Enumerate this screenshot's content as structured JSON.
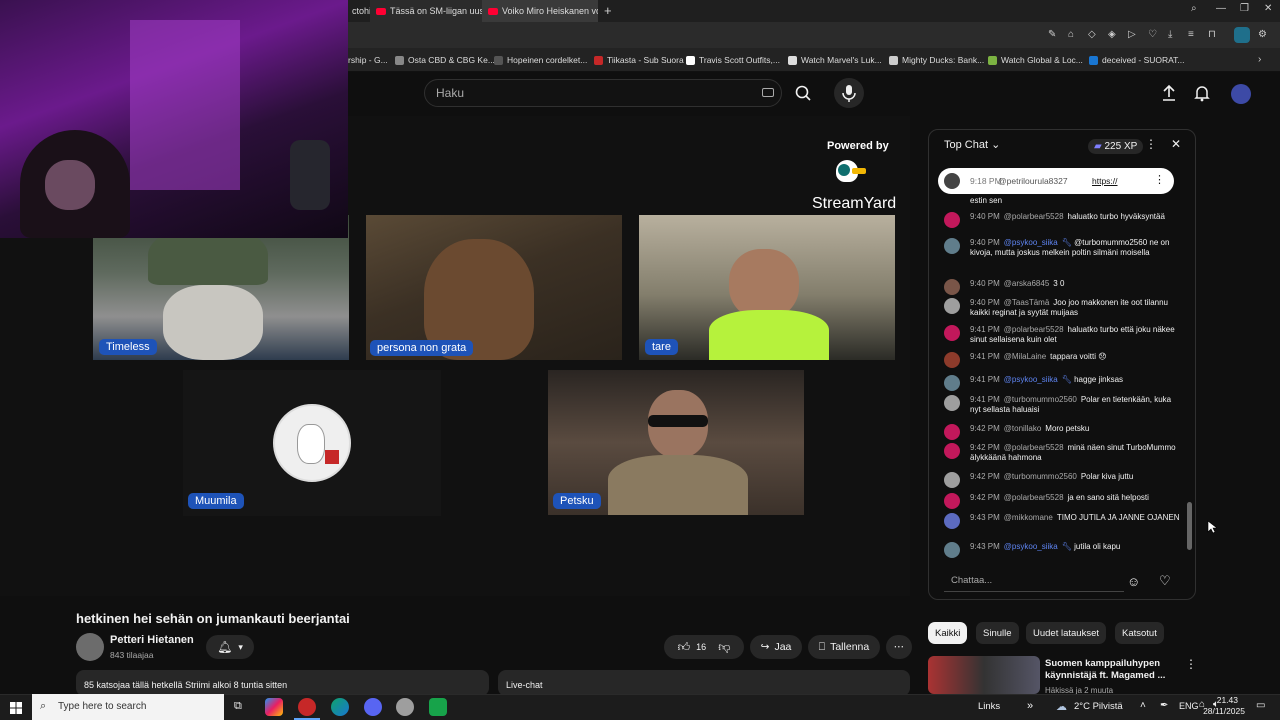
{
  "tabs": [
    {
      "title": "ctohi"
    },
    {
      "title": "Tässä on SM-liigan uusi c"
    },
    {
      "title": "Voiko Miro Heiskanen voi"
    }
  ],
  "bookmarks": [
    {
      "label": "rship - G..."
    },
    {
      "label": "Osta CBD & CBG Ke..."
    },
    {
      "label": "Hopeinen cordelket..."
    },
    {
      "label": "Tiikasta - Sub Suora"
    },
    {
      "label": "Travis Scott Outfits,..."
    },
    {
      "label": "Watch Marvel's Luk..."
    },
    {
      "label": "Mighty Ducks: Bank..."
    },
    {
      "label": "Watch Global & Loc..."
    },
    {
      "label": "deceived - SUORAT..."
    }
  ],
  "search": {
    "placeholder": "Haku"
  },
  "stream": {
    "powered_by": "Powered by",
    "brand": "StreamYard",
    "participants": [
      {
        "name": "Timeless"
      },
      {
        "name": "persona non grata"
      },
      {
        "name": "tare"
      },
      {
        "name": "Muumila"
      },
      {
        "name": "Petsku"
      }
    ]
  },
  "video": {
    "title": "hetkinen hei sehän on jumankauti beerjantai",
    "channel": "Petteri Hietanen",
    "subscribers": "843 tilaajaa",
    "likes": "16",
    "share_label": "Jaa",
    "save_label": "Tallenna",
    "description": "85 katsojaa tällä hetkellä  Striimi alkoi 8 tuntia sitten",
    "livechat_label": "Live-chat"
  },
  "chat": {
    "mode": "Top Chat",
    "xp": "225 XP",
    "pinned": {
      "time": "9:18 PM",
      "author": "@petrilourula8327",
      "text": "https://"
    },
    "messages": [
      {
        "time": "",
        "author": "",
        "text": "estin sen",
        "color": "#444444",
        "mod": false
      },
      {
        "time": "9:40 PM",
        "author": "@polarbear5528",
        "text": "haluatko turbo hyväksyntää",
        "color": "#c2185b",
        "mod": false
      },
      {
        "time": "9:40 PM",
        "author": "@psykoo_siika",
        "text": "@turbomummo2560 ne on kivoja, mutta joskus melkein poltin silmäni moisella",
        "color": "#607d8b",
        "mod": true
      },
      {
        "time": "9:40 PM",
        "author": "@arska6845",
        "text": "3 0",
        "color": "#795548",
        "mod": false
      },
      {
        "time": "9:40 PM",
        "author": "@TaasTämä",
        "text": "Joo joo makkonen ite oot tilannu kaikki reginat ja syytät muijaas",
        "color": "#9e9e9e",
        "mod": false
      },
      {
        "time": "9:41 PM",
        "author": "@polarbear5528",
        "text": "haluatko turbo että joku näkee sinut sellaisena kuin olet",
        "color": "#c2185b",
        "mod": false
      },
      {
        "time": "9:41 PM",
        "author": "@MilaLaine",
        "text": "tappara voitti 😞",
        "color": "#8d3b2b",
        "mod": false
      },
      {
        "time": "9:41 PM",
        "author": "@psykoo_siika",
        "text": "hagge jinksas",
        "color": "#607d8b",
        "mod": true
      },
      {
        "time": "9:41 PM",
        "author": "@turbomummo2560",
        "text": "Polar en tietenkään, kuka nyt sellasta haluaisi",
        "color": "#9e9e9e",
        "mod": false
      },
      {
        "time": "9:42 PM",
        "author": "@tonillako",
        "text": "Moro petsku",
        "color": "#c2185b",
        "mod": false
      },
      {
        "time": "9:42 PM",
        "author": "@polarbear5528",
        "text": "minä näen sinut TurboMummo älykkäänä hahmona",
        "color": "#c2185b",
        "mod": false
      },
      {
        "time": "9:42 PM",
        "author": "@turbomummo2560",
        "text": "Polar kiva juttu",
        "color": "#9e9e9e",
        "mod": false
      },
      {
        "time": "9:42 PM",
        "author": "@polarbear5528",
        "text": "ja en sano sitä helposti",
        "color": "#c2185b",
        "mod": false
      },
      {
        "time": "9:43 PM",
        "author": "@mikkomane",
        "text": "TIMO JUTILA JA JANNE OJANEN",
        "color": "#5c6bc0",
        "mod": false
      },
      {
        "time": "9:43 PM",
        "author": "@psykoo_siika",
        "text": "jutila oli kapu",
        "color": "#607d8b",
        "mod": true
      }
    ],
    "input_placeholder": "Chattaa..."
  },
  "filters": [
    {
      "label": "Kaikki",
      "active": true
    },
    {
      "label": "Sinulle",
      "active": false
    },
    {
      "label": "Uudet lataukset",
      "active": false
    },
    {
      "label": "Katsotut",
      "active": false
    }
  ],
  "recommended": {
    "title": "Suomen kamppailuhypen käynnistäjä ft. Magamed ...",
    "channel": "Häkissä ja 2 muuta"
  },
  "taskbar": {
    "search_placeholder": "Type here to search",
    "links": "Links",
    "weather": "2°C  Pilvistä",
    "language": "ENG",
    "time": "21.43",
    "date": "28/11/2025"
  }
}
